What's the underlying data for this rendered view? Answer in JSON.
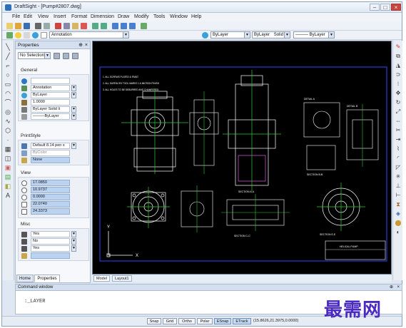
{
  "window": {
    "title": "DraftSight - [Pump#2807.dwg]",
    "controls": [
      "–",
      "□",
      "×"
    ]
  },
  "menubar": {
    "items": [
      "File",
      "Edit",
      "View",
      "Insert",
      "Format",
      "Dimension",
      "Draw",
      "Modify",
      "Tools",
      "Window",
      "Help"
    ]
  },
  "toolbar2": {
    "layer_combo": "Annotation",
    "color_combo": "ByLayer",
    "linetype_combo_label": "ByLayer",
    "linetype_style": "Solid line",
    "lineweight_combo": "ByLayer"
  },
  "properties": {
    "title": "Properties",
    "pin": "⊕",
    "close": "×",
    "selection": "No Selection",
    "sections": {
      "general": {
        "title": "General",
        "rows": [
          "",
          "Annotation",
          "ByLayer",
          "1.0000",
          "ByLayer   Solid li",
          "———ByLayer"
        ]
      },
      "printstyle": {
        "title": "PrintStyle",
        "rows": [
          "Default 8.14 pen s",
          "ByColor",
          "None"
        ]
      },
      "view": {
        "title": "View",
        "rows": [
          "17.0850",
          "10.9737",
          "0.0000",
          "22.0740",
          "24.3373"
        ]
      },
      "misc": {
        "title": "Misc",
        "rows": [
          "Yes",
          "No",
          "Yes",
          ""
        ]
      }
    },
    "tabs": [
      "Home",
      "Properties"
    ]
  },
  "canvas": {
    "tabs": [
      "Model",
      "Layout1"
    ],
    "notes": [
      "1. ALL SCREWS PLATED & PAINT.",
      "2. ALL SURFACES TOOL MARKS 1.6 MICRON FINISH",
      "3. ALL HOLES TO BE DEBURRED AND CHAMFERED."
    ],
    "section_labels": [
      "SECTION A-A",
      "SECTION B-B",
      "DETAIL A",
      "DETAIL B",
      "SECTION C-C",
      "SECTION E-E"
    ],
    "title_block": "HELICAL PUMP",
    "ucs_x": "X",
    "ucs_y": "Y"
  },
  "command_window": {
    "title": "Command window",
    "pin": "⊕",
    "close": "×",
    "line": ":_LAYER"
  },
  "statusbar": {
    "buttons": [
      {
        "label": "Snap",
        "on": false
      },
      {
        "label": "Grid",
        "on": false
      },
      {
        "label": "Ortho",
        "on": false
      },
      {
        "label": "Polar",
        "on": false
      },
      {
        "label": "ESnap",
        "on": true
      },
      {
        "label": "ETrack",
        "on": true
      }
    ],
    "coords": "(15.8626,21.3975,0.0000)"
  },
  "watermark": "最需网",
  "colors": {
    "canvas_bg": "#000000",
    "drawing_main": "#ffffff",
    "drawing_green": "#33cc33",
    "drawing_cyan": "#55ccff",
    "drawing_yellow": "#f0e040",
    "drawing_magenta": "#dd55dd",
    "border_blue": "#3344ff",
    "watermark": "#4a2ac0"
  },
  "icons": {
    "left_strip": [
      "line-icon",
      "polyline-icon",
      "circle-icon",
      "rectangle-icon",
      "arc-icon",
      "spline-icon",
      "ellipse-icon",
      "hatch-icon",
      "text-icon",
      "point-icon"
    ],
    "right_strip": [
      "erase-icon",
      "copy-icon",
      "mirror-icon",
      "offset-icon",
      "array-icon",
      "move-icon",
      "rotate-icon",
      "scale-icon",
      "trim-icon",
      "extend-icon",
      "fillet-icon",
      "chamfer-icon",
      "explode-icon"
    ]
  }
}
